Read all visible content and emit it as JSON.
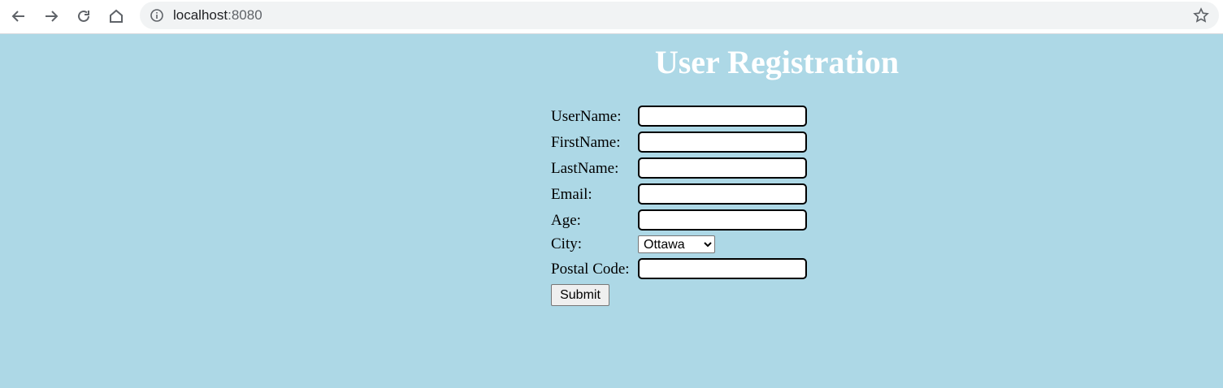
{
  "browser": {
    "url_host": "localhost",
    "url_port": ":8080"
  },
  "page": {
    "title": "User Registration",
    "background_color": "#add8e6"
  },
  "form": {
    "fields": {
      "username": {
        "label": "UserName:",
        "value": ""
      },
      "firstname": {
        "label": "FirstName:",
        "value": ""
      },
      "lastname": {
        "label": "LastName:",
        "value": ""
      },
      "email": {
        "label": "Email:",
        "value": ""
      },
      "age": {
        "label": "Age:",
        "value": ""
      },
      "city": {
        "label": "City:",
        "selected": "Ottawa"
      },
      "postal": {
        "label": "Postal Code:",
        "value": ""
      }
    },
    "submit_label": "Submit"
  }
}
